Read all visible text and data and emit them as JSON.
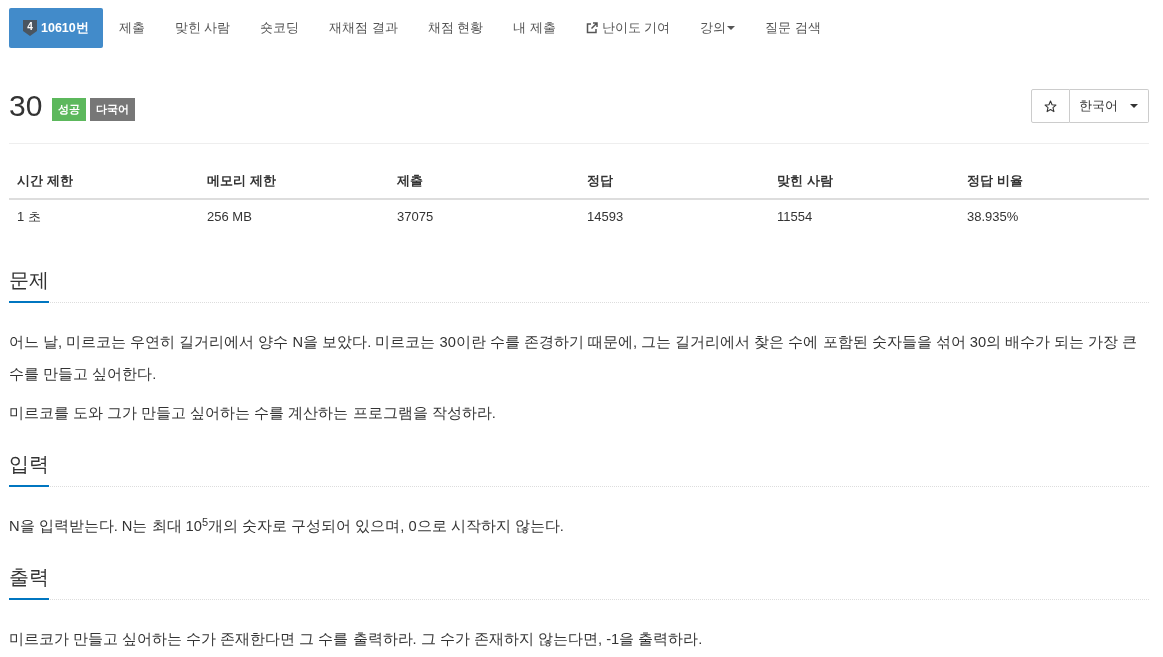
{
  "nav": {
    "tabs": [
      {
        "label": "10610번",
        "badge": "4",
        "kind": "plain",
        "selected": true
      },
      {
        "label": "제출",
        "kind": "plain",
        "selected": false
      },
      {
        "label": "맞힌 사람",
        "kind": "plain",
        "selected": false
      },
      {
        "label": "숏코딩",
        "kind": "plain",
        "selected": false
      },
      {
        "label": "재채점 결과",
        "kind": "plain",
        "selected": false
      },
      {
        "label": "채점 현황",
        "kind": "plain",
        "selected": false
      },
      {
        "label": "내 제출",
        "kind": "plain",
        "selected": false
      },
      {
        "label": "난이도 기여",
        "kind": "external",
        "selected": false
      },
      {
        "label": "강의",
        "kind": "dropdown",
        "selected": false
      },
      {
        "label": "질문 검색",
        "kind": "plain",
        "selected": false
      }
    ]
  },
  "problem": {
    "title": "30",
    "labels": [
      {
        "text": "성공",
        "color": "#5cb85c"
      },
      {
        "text": "다국어",
        "color": "#777777"
      }
    ]
  },
  "toolbar": {
    "favorite": false,
    "language": "한국어"
  },
  "info_table": {
    "columns": [
      "시간 제한",
      "메모리 제한",
      "제출",
      "정답",
      "맞힌 사람",
      "정답 비율"
    ],
    "rows": [
      [
        "1 초",
        "256 MB",
        "37075",
        "14593",
        "11554",
        "38.935%"
      ]
    ]
  },
  "sections": [
    {
      "title": "문제",
      "paragraphs": [
        "어느 날, 미르코는 우연히 길거리에서 양수 N을 보았다. 미르코는 30이란 수를 존경하기 때문에, 그는 길거리에서 찾은 수에 포함된 숫자들을 섞어 30의 배수가 되는 가장 큰 수를 만들고 싶어한다.",
        "미르코를 도와 그가 만들고 싶어하는 수를 계산하는 프로그램을 작성하라."
      ]
    },
    {
      "title": "입력",
      "paragraphs": [
        "N을 입력받는다. N는 최대 10$^{5}$개의 숫자로 구성되어 있으며, 0으로 시작하지 않는다."
      ]
    },
    {
      "title": "출력",
      "paragraphs": [
        "미르코가 만들고 싶어하는 수가 존재한다면 그 수를 출력하라. 그 수가 존재하지 않는다면, -1을 출력하라."
      ]
    }
  ]
}
